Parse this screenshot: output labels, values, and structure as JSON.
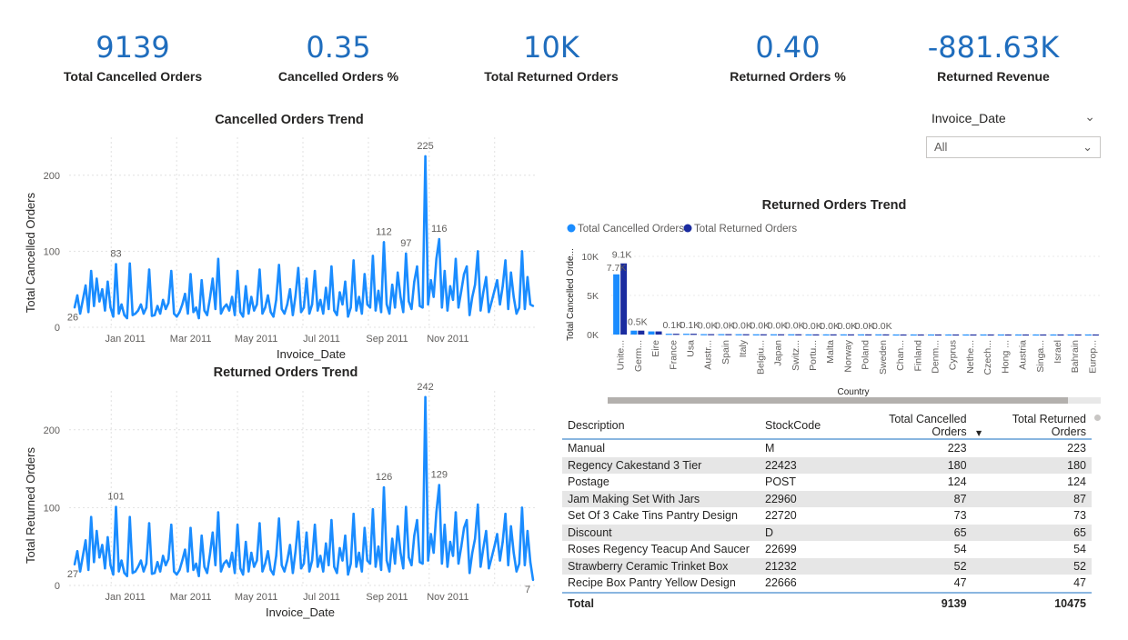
{
  "kpis": [
    {
      "value": "9139",
      "label": "Total Cancelled Orders"
    },
    {
      "value": "0.35",
      "label": "Cancelled Orders %"
    },
    {
      "value": "10K",
      "label": "Total Returned Orders"
    },
    {
      "value": "0.40",
      "label": "Returned Orders %"
    },
    {
      "value": "-881.63K",
      "label": "Returned Revenue"
    }
  ],
  "slicer": {
    "title": "Invoice_Date",
    "selected": "All"
  },
  "colors": {
    "line": "#1a8cff",
    "cancelled": "#1a8cff",
    "returned": "#1b2ca0",
    "kpi": "#1f6dbd"
  },
  "chart_data": [
    {
      "type": "line",
      "title": "Cancelled Orders Trend",
      "xlabel": "Invoice_Date",
      "ylabel": "Total Cancelled Orders",
      "x_tick_labels": [
        "Jan 2011",
        "Mar 2011",
        "May 2011",
        "Jul 2011",
        "Sep 2011",
        "Nov 2011"
      ],
      "y_ticks": [
        0,
        100,
        200
      ],
      "ylim": [
        0,
        250
      ],
      "grid": true,
      "data_labels": [
        "26",
        "83",
        "112",
        "97",
        "225",
        "116"
      ],
      "series": [
        {
          "values": [
            26,
            42,
            18,
            36,
            55,
            20,
            74,
            28,
            64,
            34,
            50,
            22,
            60,
            26,
            14,
            83,
            18,
            30,
            16,
            12,
            84,
            16,
            18,
            22,
            30,
            18,
            26,
            76,
            15,
            16,
            28,
            18,
            36,
            24,
            32,
            74,
            18,
            14,
            20,
            30,
            44,
            18,
            70,
            20,
            26,
            12,
            62,
            22,
            16,
            38,
            64,
            24,
            90,
            18,
            26,
            30,
            22,
            40,
            16,
            74,
            20,
            14,
            54,
            18,
            40,
            22,
            30,
            76,
            18,
            26,
            42,
            20,
            14,
            36,
            82,
            24,
            18,
            30,
            50,
            16,
            42,
            78,
            20,
            26,
            64,
            18,
            30,
            74,
            22,
            36,
            18,
            52,
            24,
            80,
            22,
            16,
            46,
            30,
            60,
            14,
            26,
            88,
            22,
            40,
            18,
            70,
            30,
            26,
            94,
            22,
            48,
            20,
            112,
            30,
            18,
            56,
            26,
            72,
            40,
            20,
            97,
            34,
            24,
            60,
            80,
            28,
            26,
            225,
            30,
            62,
            40,
            90,
            116,
            26,
            74,
            22,
            54,
            36,
            90,
            26,
            48,
            70,
            80,
            16,
            40,
            56,
            100,
            22,
            46,
            66,
            20,
            34,
            48,
            62,
            30,
            54,
            88,
            24,
            72,
            40,
            18,
            26,
            100,
            24,
            66,
            30,
            28
          ]
        }
      ]
    },
    {
      "type": "line",
      "title": "Returned Orders Trend",
      "xlabel": "Invoice_Date",
      "ylabel": "Total Returned Orders",
      "x_tick_labels": [
        "Jan 2011",
        "Mar 2011",
        "May 2011",
        "Jul 2011",
        "Sep 2011",
        "Nov 2011"
      ],
      "y_ticks": [
        0,
        100,
        200
      ],
      "ylim": [
        0,
        250
      ],
      "grid": true,
      "data_labels": [
        "27",
        "101",
        "126",
        "242",
        "129",
        "7"
      ],
      "series": [
        {
          "values": [
            27,
            44,
            18,
            38,
            58,
            20,
            88,
            30,
            70,
            36,
            52,
            22,
            62,
            26,
            14,
            101,
            18,
            32,
            16,
            12,
            88,
            16,
            18,
            24,
            32,
            18,
            28,
            80,
            15,
            16,
            30,
            18,
            38,
            26,
            34,
            78,
            18,
            14,
            20,
            32,
            46,
            18,
            74,
            20,
            28,
            12,
            64,
            24,
            16,
            40,
            68,
            26,
            94,
            18,
            28,
            32,
            24,
            42,
            16,
            78,
            22,
            14,
            56,
            18,
            42,
            24,
            32,
            80,
            18,
            28,
            44,
            20,
            14,
            38,
            86,
            26,
            18,
            32,
            52,
            16,
            44,
            82,
            22,
            28,
            68,
            18,
            32,
            78,
            24,
            38,
            18,
            54,
            26,
            84,
            24,
            16,
            48,
            32,
            64,
            14,
            28,
            92,
            24,
            42,
            18,
            74,
            32,
            28,
            98,
            24,
            50,
            20,
            126,
            32,
            18,
            60,
            28,
            76,
            42,
            22,
            101,
            36,
            26,
            64,
            84,
            30,
            28,
            242,
            32,
            66,
            42,
            94,
            129,
            28,
            78,
            24,
            56,
            38,
            94,
            28,
            50,
            74,
            84,
            16,
            42,
            60,
            104,
            24,
            48,
            70,
            22,
            36,
            50,
            66,
            32,
            56,
            92,
            26,
            76,
            42,
            18,
            28,
            100,
            26,
            70,
            30,
            7
          ]
        }
      ]
    },
    {
      "type": "bar",
      "title": "Returned Orders Trend",
      "xlabel": "Country",
      "ylabel": "Total Cancelled Orde...",
      "y_tick_labels": [
        "0K",
        "5K",
        "10K"
      ],
      "ylim": [
        0,
        10000
      ],
      "legend": "top-left",
      "categories": [
        "Unite...",
        "Germ...",
        "Eire",
        "France",
        "Usa",
        "Austr...",
        "Spain",
        "Italy",
        "Belgiu...",
        "Japan",
        "Switz...",
        "Portu...",
        "Malta",
        "Norway",
        "Poland",
        "Sweden",
        "Chan...",
        "Finland",
        "Denm...",
        "Cyprus",
        "Nethe...",
        "Czech...",
        "Hong ...",
        "Austria",
        "Singa...",
        "Israel",
        "Bahrain",
        "Europ..."
      ],
      "series": [
        {
          "name": "Total Cancelled Orders",
          "values": [
            7700,
            500,
            400,
            100,
            100,
            50,
            50,
            40,
            30,
            30,
            30,
            20,
            20,
            20,
            20,
            20,
            10,
            10,
            10,
            10,
            10,
            10,
            10,
            10,
            10,
            10,
            10,
            10
          ]
        },
        {
          "name": "Total Returned Orders",
          "values": [
            9100,
            500,
            400,
            100,
            100,
            50,
            50,
            40,
            30,
            30,
            30,
            20,
            20,
            20,
            20,
            20,
            10,
            10,
            10,
            10,
            10,
            10,
            10,
            10,
            10,
            10,
            10,
            10
          ]
        }
      ],
      "data_labels": [
        "9.1K",
        "0.5K",
        "",
        "0.1K",
        "0.1K",
        "0.0K",
        "0.0K",
        "0.0K",
        "0.0K",
        "0.0K",
        "0.0K",
        "0.0K",
        "0.0K",
        "0.0K",
        "0.0K",
        "0.0K"
      ],
      "data_label_first_cancelled": "7.7K"
    }
  ],
  "table": {
    "columns": [
      "Description",
      "StockCode",
      "Total Cancelled Orders",
      "Total Returned Orders"
    ],
    "rows": [
      [
        "Manual",
        "M",
        "223",
        "223"
      ],
      [
        "Regency Cakestand 3 Tier",
        "22423",
        "180",
        "180"
      ],
      [
        "Postage",
        "POST",
        "124",
        "124"
      ],
      [
        "Jam Making Set With Jars",
        "22960",
        "87",
        "87"
      ],
      [
        "Set Of 3 Cake Tins Pantry Design",
        "22720",
        "73",
        "73"
      ],
      [
        "Discount",
        "D",
        "65",
        "65"
      ],
      [
        "Roses Regency Teacup And Saucer",
        "22699",
        "54",
        "54"
      ],
      [
        "Strawberry Ceramic Trinket Box",
        "21232",
        "52",
        "52"
      ],
      [
        "Recipe Box Pantry Yellow Design",
        "22666",
        "47",
        "47"
      ]
    ],
    "total": [
      "Total",
      "",
      "9139",
      "10475"
    ]
  }
}
